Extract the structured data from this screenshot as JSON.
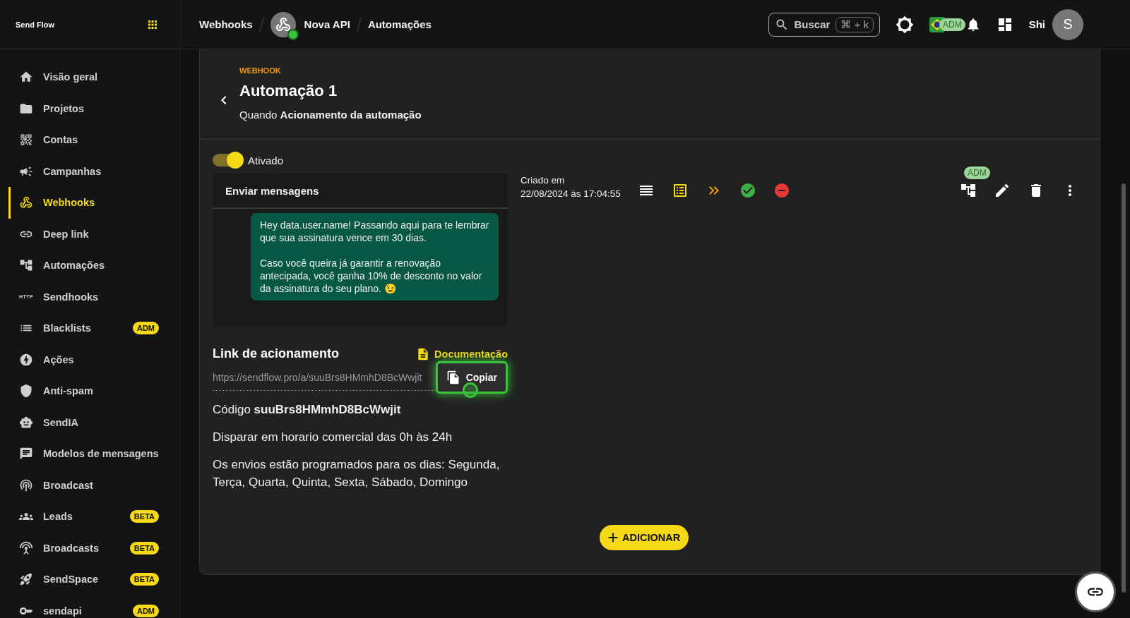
{
  "brand": {
    "name": "Send Flow"
  },
  "breadcrumb": [
    {
      "label": "Webhooks",
      "kind": "text"
    },
    {
      "label": "Nova API",
      "kind": "avatar",
      "online": true
    },
    {
      "label": "Automações",
      "kind": "text"
    }
  ],
  "search": {
    "label": "Buscar",
    "shortcut": "⌘ + k"
  },
  "header": {
    "adm_badge": "ADM",
    "user": "Shi",
    "avatar_letter": "S"
  },
  "sidebar": {
    "items": [
      {
        "label": "Visão geral",
        "selected": false
      },
      {
        "label": "Projetos",
        "selected": false
      },
      {
        "label": "Contas",
        "selected": false
      },
      {
        "label": "Campanhas",
        "selected": false
      },
      {
        "label": "Webhooks",
        "selected": true
      },
      {
        "label": "Deep link",
        "selected": false
      },
      {
        "label": "Automações",
        "selected": false
      },
      {
        "label": "Sendhooks",
        "selected": false,
        "icon_text": "HTTP"
      },
      {
        "label": "Blacklists",
        "selected": false,
        "badge": "ADM"
      },
      {
        "label": "Ações",
        "selected": false
      },
      {
        "label": "Anti-spam",
        "selected": false
      },
      {
        "label": "SendIA",
        "selected": false
      },
      {
        "label": "Modelos de mensagens",
        "selected": false
      },
      {
        "label": "Broadcast",
        "selected": false
      },
      {
        "label": "Leads",
        "selected": false,
        "badge": "BETA"
      },
      {
        "label": "Broadcasts",
        "selected": false,
        "badge": "BETA"
      },
      {
        "label": "SendSpace",
        "selected": false,
        "badge": "BETA"
      },
      {
        "label": "sendapi",
        "selected": false,
        "badge": "ADM"
      }
    ]
  },
  "page": {
    "overline": "WEBHOOK",
    "title": "Automação 1",
    "trigger_prefix": "Quando",
    "trigger": "Acionamento da automação"
  },
  "toggle": {
    "label": "Ativado",
    "on": true
  },
  "message_card": {
    "title": "Enviar mensagens",
    "paragraphs": [
      "Hey data.user.name! Passando aqui para te lembrar que sua assinatura vence em 30 dias.",
      "Caso você queira já garantir a renovação antecipada, você ganha 10% de desconto no valor da assinatura do seu plano. 😉"
    ]
  },
  "created": {
    "label": "Criado em",
    "value": "22/08/2024 às 17:04:55"
  },
  "actions_badge": "ADM",
  "link": {
    "title": "Link de acionamento",
    "doc_link": "Documentação",
    "url": "https://sendflow.pro/a/suuBrs8HMmhD8BcWwjit",
    "copy_label": "Copiar",
    "copy_highlighted": true
  },
  "details": {
    "code_label": "Código",
    "code": "suuBrs8HMmhD8BcWwjit",
    "schedule": "Disparar em horario comercial das 0h às 24h",
    "days": "Os envios estão programados para os dias: Segunda, Terça, Quarta, Quinta, Sexta, Sábado, Domingo"
  },
  "add_button": "ADICIONAR"
}
